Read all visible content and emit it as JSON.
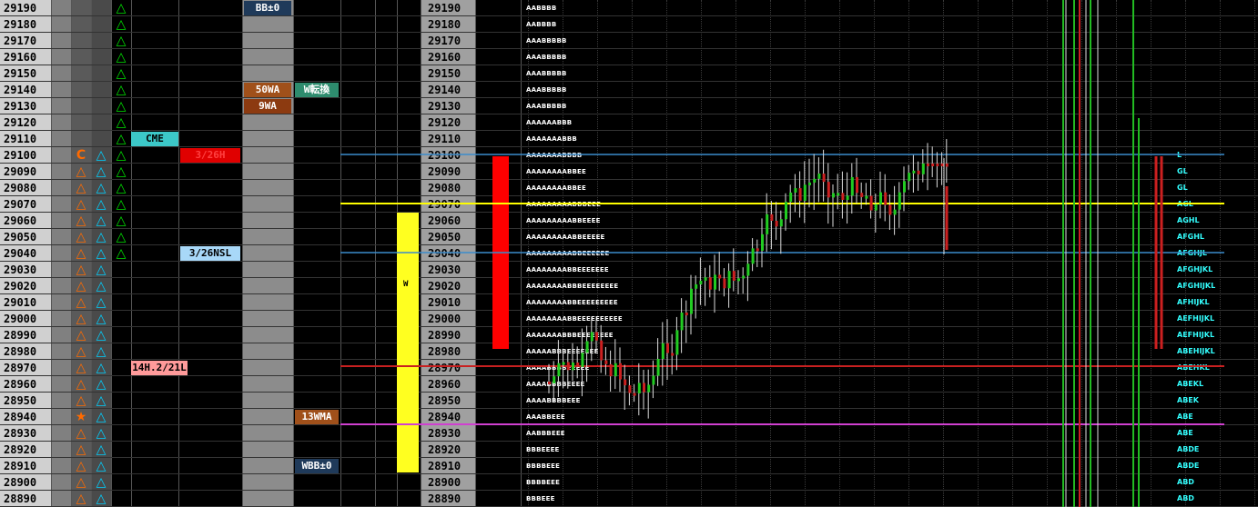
{
  "prices": [
    "29190",
    "29180",
    "29170",
    "29160",
    "29150",
    "29140",
    "29130",
    "29120",
    "29110",
    "29100",
    "29090",
    "29080",
    "29070",
    "29060",
    "29050",
    "29040",
    "29030",
    "29020",
    "29010",
    "29000",
    "28990",
    "28980",
    "28970",
    "28960",
    "28950",
    "28940",
    "28930",
    "28920",
    "28910",
    "28900",
    "28890"
  ],
  "left_panel": {
    "labels": {
      "bb": "BB±0",
      "ma50": "50WA",
      "wtenkan": "W転換",
      "ma9": "9WA",
      "cme": "CME",
      "h326": "3/26H",
      "nsl326": "3/26NSL",
      "h14": "14H.2/21L",
      "ma13": "13WMA",
      "wbb": "WBB±0",
      "w_marker": "W"
    },
    "c_marker": "C",
    "star_marker": "★",
    "triangle_glyph": "△",
    "colors": {
      "orange": "#ff6a00",
      "cyan": "#00cfff",
      "green": "#00e000"
    }
  },
  "tpo_rows": [
    "AABBBB",
    "AABBBB",
    "AAABBBBB",
    "AAABBBBB",
    "AAABBBBB",
    "AAABBBBB",
    "AAABBBBB",
    "AAAAAABBB",
    "AAAAAAABBB",
    "AAAAAAABBBB",
    "AAAAAAAABBEE",
    "AAAAAAAABBEE",
    "AAAAAAAAABBBEEE",
    "AAAAAAAAABBEEEE",
    "AAAAAAAAABBEEEEE",
    "AAAAAAAAABBEEEEEE",
    "AAAAAAAABBEEEEEEE",
    "AAAAAAAABBBEEEEEEEE",
    "AAAAAAAABBEEEEEEEEE",
    "AAAAAAAABBEEEEEEEEEE",
    "AAAAAAABBBEEEEEEEE",
    "AAAAABBBEEEEEEE",
    "AAAABBBBEEEEE",
    "AAAABBBBEEEE",
    "AAAABBBBEEE",
    "AAABBEEE",
    "AABBBEEE",
    "BBBEEEE",
    "BBBBEEE",
    "BBBBEEE",
    "BBBEEE"
  ],
  "right_labels": [
    "",
    "",
    "",
    "",
    "",
    "",
    "",
    "",
    "",
    "L",
    "GL",
    "GL",
    "AGL",
    "AGHL",
    "AFGHL",
    "AFGHJL",
    "AFGHJKL",
    "AFGHIJKL",
    "AFHIJKL",
    "AEFHIJKL",
    "AEFHIJKL",
    "ABEHIJKL",
    "ABEHKL",
    "ABEKL",
    "ABEK",
    "ABE",
    "ABE",
    "ABDE",
    "ABDE",
    "ABD",
    "ABD"
  ]
}
